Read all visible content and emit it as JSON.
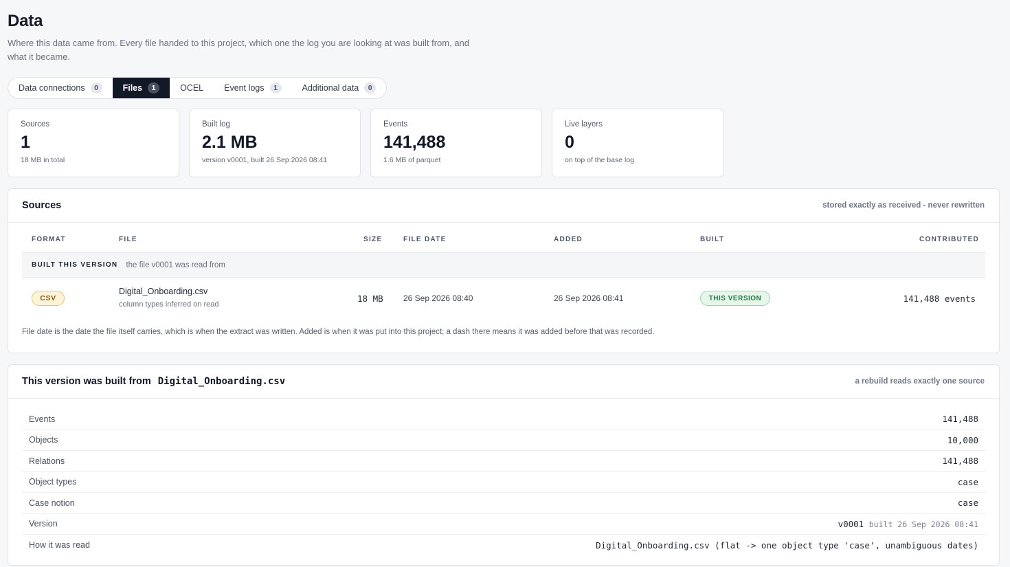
{
  "header": {
    "title": "Data",
    "description": "Where this data came from. Every file handed to this project, which one the log you are looking at was built from, and what it became."
  },
  "tabs": [
    {
      "label": "Data connections",
      "count": "0"
    },
    {
      "label": "Files",
      "count": "1",
      "active": true
    },
    {
      "label": "OCEL",
      "count": ""
    },
    {
      "label": "Event logs",
      "count": "1"
    },
    {
      "label": "Additional data",
      "count": "0"
    }
  ],
  "stats": {
    "sources": {
      "label": "Sources",
      "value": "1",
      "sub": "18 MB in total"
    },
    "built_log": {
      "label": "Built log",
      "value": "2.1 MB",
      "sub": "version v0001, built 26 Sep 2026 08:41"
    },
    "events": {
      "label": "Events",
      "value": "141,488",
      "sub": "1.6 MB of parquet"
    },
    "live_layers": {
      "label": "Live layers",
      "value": "0",
      "sub": "on top of the base log"
    }
  },
  "sources_panel": {
    "title": "Sources",
    "note": "stored exactly as received - never rewritten",
    "columns": {
      "format": "FORMAT",
      "file": "FILE",
      "size": "SIZE",
      "file_date": "FILE DATE",
      "added": "ADDED",
      "built": "BUILT",
      "contributed": "CONTRIBUTED"
    },
    "group": {
      "label": "BUILT THIS VERSION",
      "note": "the file v0001 was read from"
    },
    "row": {
      "format": "CSV",
      "file": "Digital_Onboarding.csv",
      "file_sub": "column types inferred on read",
      "size": "18 MB",
      "file_date": "26 Sep 2026 08:40",
      "added": "26 Sep 2026 08:41",
      "built": "THIS VERSION",
      "contributed": "141,488 events"
    },
    "footnote": "File date is the date the file itself carries, which is when the extract was written. Added is when it was put into this project; a dash there means it was added before that was recorded."
  },
  "build_panel": {
    "title": "This version was built from",
    "file": "Digital_Onboarding.csv",
    "note": "a rebuild reads exactly one source",
    "rows": [
      {
        "key": "Events",
        "value": "141,488"
      },
      {
        "key": "Objects",
        "value": "10,000"
      },
      {
        "key": "Relations",
        "value": "141,488"
      },
      {
        "key": "Object types",
        "value": "case"
      },
      {
        "key": "Case notion",
        "value": "case"
      },
      {
        "key": "Version",
        "value": "v0001",
        "extra": "built 26 Sep 2026 08:41"
      },
      {
        "key": "How it was read",
        "value": "Digital_Onboarding.csv (flat -> one object type 'case', unambiguous dates)"
      }
    ]
  }
}
